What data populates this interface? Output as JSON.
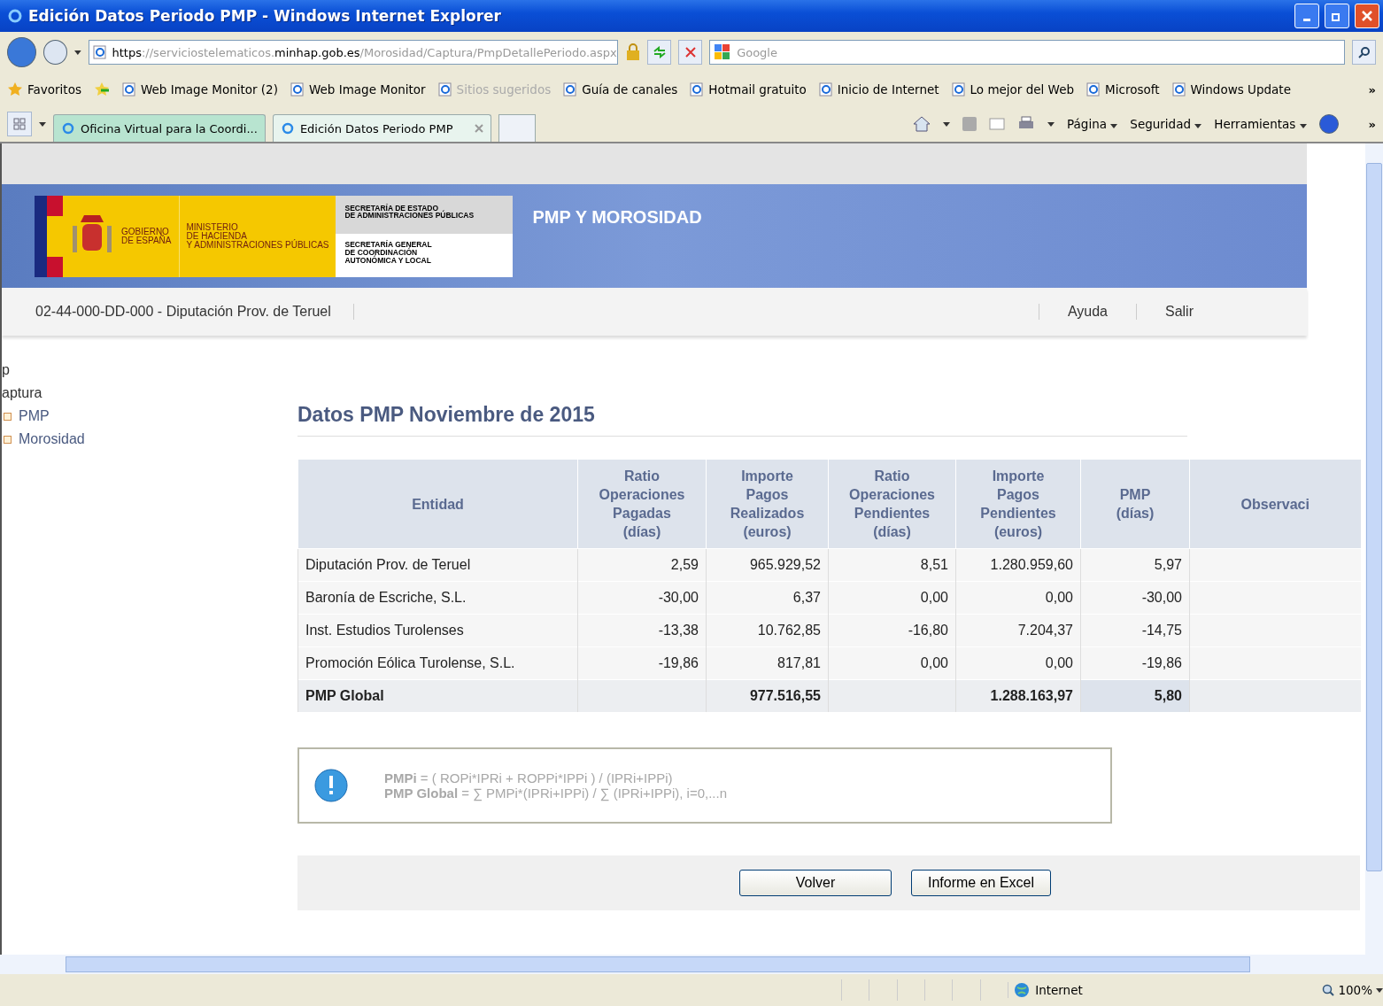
{
  "window": {
    "title": "Edición Datos Periodo PMP - Windows Internet Explorer"
  },
  "address": {
    "url": [
      {
        "text": "https",
        "strong": true
      },
      {
        "text": "://serviciostelematicos.",
        "strong": false
      },
      {
        "text": "minhap.gob.es",
        "strong": true
      },
      {
        "text": "/Morosidad/Captura/PmpDetallePeriodo.aspx",
        "strong": false
      }
    ],
    "search_placeholder": "Google"
  },
  "favorites": {
    "label": "Favoritos",
    "items": [
      {
        "label": "Web Image Monitor (2)",
        "disabled": false
      },
      {
        "label": "Web Image Monitor",
        "disabled": false
      },
      {
        "label": "Sitios sugeridos",
        "disabled": true
      },
      {
        "label": "Guía de canales",
        "disabled": false
      },
      {
        "label": "Hotmail gratuito",
        "disabled": false
      },
      {
        "label": "Inicio de Internet",
        "disabled": false
      },
      {
        "label": "Lo mejor del Web",
        "disabled": false
      },
      {
        "label": "Microsoft",
        "disabled": false
      },
      {
        "label": "Windows Update",
        "disabled": false
      }
    ],
    "more": "»"
  },
  "tabs": [
    {
      "label": "Oficina Virtual para la Coordi...",
      "selected": false
    },
    {
      "label": "Edición Datos Periodo PMP",
      "selected": true
    }
  ],
  "command_bar": {
    "menus": [
      "Página",
      "Seguridad",
      "Herramientas"
    ],
    "more": "»"
  },
  "header": {
    "logo_lines": {
      "gobierno": "GOBIERNO\nDE ESPAÑA",
      "ministerio": "MINISTERIO\nDE HACIENDA\nY ADMINISTRACIONES PÚBLICAS",
      "secretaria_estado": "SECRETARÍA DE ESTADO\nDE ADMINISTRACIONES PÚBLICAS",
      "secretaria_general": "SECRETARÍA GENERAL\nDE COORDINACIÓN\nAUTONÓMICA Y LOCAL"
    },
    "title": "PMP Y MOROSIDAD"
  },
  "user_bar": {
    "entity": "02-44-000-DD-000 - Diputación Prov. de Teruel",
    "links": [
      "Ayuda",
      "Salir"
    ]
  },
  "sidebar": {
    "items": [
      {
        "label": "p"
      },
      {
        "label": "aptura",
        "children": [
          {
            "label": "PMP"
          },
          {
            "label": "Morosidad"
          }
        ]
      }
    ]
  },
  "content": {
    "heading": "Datos PMP Noviembre de 2015",
    "table": {
      "columns": [
        "Entidad",
        "Ratio\nOperaciones\nPagadas\n(días)",
        "Importe\nPagos\nRealizados\n(euros)",
        "Ratio\nOperaciones\nPendientes\n(días)",
        "Importe\nPagos\nPendientes\n(euros)",
        "PMP\n(días)",
        "Observaci"
      ],
      "rows": [
        {
          "cells": [
            "Diputación Prov. de Teruel",
            "2,59",
            "965.929,52",
            "8,51",
            "1.280.959,60",
            "5,97",
            ""
          ],
          "total": false
        },
        {
          "cells": [
            "Baronía de Escriche, S.L.",
            "-30,00",
            "6,37",
            "0,00",
            "0,00",
            "-30,00",
            ""
          ],
          "total": false
        },
        {
          "cells": [
            "Inst. Estudios Turolenses",
            "-13,38",
            "10.762,85",
            "-16,80",
            "7.204,37",
            "-14,75",
            ""
          ],
          "total": false
        },
        {
          "cells": [
            "Promoción Eólica Turolense, S.L.",
            "-19,86",
            "817,81",
            "0,00",
            "0,00",
            "-19,86",
            ""
          ],
          "total": false
        },
        {
          "cells": [
            "PMP Global",
            "",
            "977.516,55",
            "",
            "1.288.163,97",
            "5,80",
            ""
          ],
          "total": true
        }
      ]
    },
    "info": {
      "lines": [
        {
          "label": "PMPi",
          "formula": " = ( ROPi*IPRi + ROPPi*IPPi ) / (IPRi+IPPi)"
        },
        {
          "label": "PMP Global",
          "formula": " = ∑ PMPi*(IPRi+IPPi) / ∑ (IPRi+IPPi), i=0,...n"
        }
      ]
    },
    "buttons": [
      "Volver",
      "Informe en Excel"
    ]
  },
  "status_bar": {
    "zone": "Internet",
    "zoom": "100%"
  }
}
